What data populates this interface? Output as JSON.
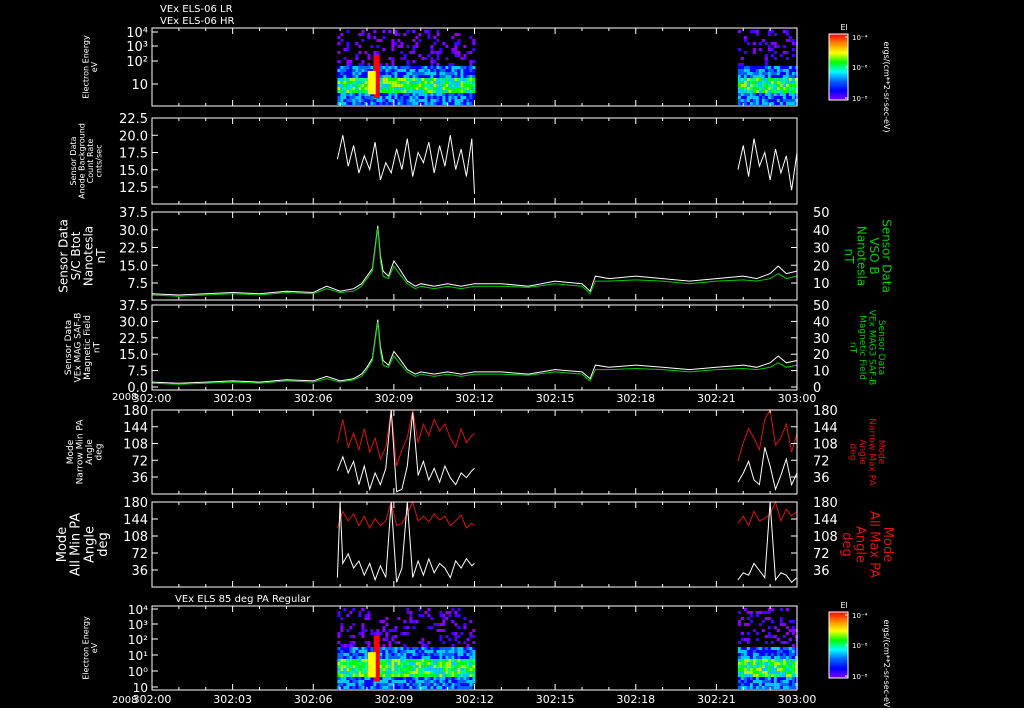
{
  "header": {
    "line1": "VEx ELS-06 LR",
    "line2": "VEx ELS-06 HR"
  },
  "bottom_header": "VEx ELS 85 deg PA Regular",
  "colorbar": {
    "title": "El",
    "ticks": [
      "10⁻⁴",
      "10⁻⁶",
      "10⁻⁸"
    ],
    "unit": "ergs/(cm**2-sr-sec-eV)",
    "colors": [
      "#ff0000",
      "#ff8800",
      "#ffff00",
      "#00ff00",
      "#00ffff",
      "#0066ff",
      "#0000ff",
      "#8800ff"
    ]
  },
  "time_axis": {
    "year": "2008",
    "labels": [
      "302:00",
      "302:03",
      "302:06",
      "302:09",
      "302:12",
      "302:15",
      "302:18",
      "302:21",
      "303:00"
    ]
  },
  "colors": {
    "primary": "#ffffff",
    "green": "#00cc00",
    "red": "#dd1111",
    "axis": "#ffffff"
  },
  "chart_data": [
    {
      "type": "heatmap",
      "title": "VEx ELS-06 LR / HR",
      "ylabel": [
        "Electron Energy",
        "eV"
      ],
      "yticks": [
        "10⁴",
        "10³",
        "10²",
        "10"
      ],
      "coverage": [
        [
          6.9,
          12.0
        ],
        [
          21.8,
          24.0
        ]
      ]
    },
    {
      "type": "line",
      "ylabel": [
        "Sensor Data",
        "Anode Background",
        "Count Rate",
        "cnts/sec"
      ],
      "ylim": [
        10,
        22.5
      ],
      "yticks": [
        "22.5",
        "20.0",
        "17.5",
        "15.0",
        "12.5"
      ],
      "series": [
        {
          "color": "white",
          "segments": [
            {
              "x": [
                6.9,
                7.1,
                7.3,
                7.5,
                7.7,
                7.9,
                8.1,
                8.3,
                8.5,
                8.7,
                8.9,
                9.1,
                9.3,
                9.5,
                9.7,
                9.9,
                10.1,
                10.3,
                10.5,
                10.7,
                10.9,
                11.1,
                11.3,
                11.5,
                11.7,
                11.9,
                12.0
              ],
              "y": [
                16.5,
                20.0,
                15.5,
                18.5,
                14.5,
                17.0,
                15.0,
                19.0,
                13.5,
                16.0,
                14.5,
                18.0,
                15.0,
                19.5,
                14.0,
                17.5,
                16.0,
                19.0,
                14.5,
                18.5,
                15.5,
                20.0,
                15.0,
                18.0,
                14.0,
                19.5,
                11.5
              ]
            },
            {
              "x": [
                21.8,
                22.0,
                22.2,
                22.4,
                22.6,
                22.8,
                23.0,
                23.2,
                23.4,
                23.6,
                23.8,
                24.0
              ],
              "y": [
                15.0,
                18.5,
                14.0,
                19.5,
                15.5,
                17.5,
                13.5,
                18.0,
                14.5,
                17.0,
                12.0,
                17.5
              ]
            }
          ]
        }
      ]
    },
    {
      "type": "line",
      "ylabel": [
        "Sensor Data",
        "S/C Btot",
        "Nanotesla",
        "nT"
      ],
      "ylabel_right": [
        "Sensor Data",
        "VSO B",
        "Nanotesla",
        "nT"
      ],
      "ylim": [
        2.5,
        37.5
      ],
      "yticks": [
        "37.5",
        "30.0",
        "22.5",
        "15.0",
        "7.5"
      ],
      "ylim_right": [
        0,
        50
      ],
      "yticks_right": [
        "50",
        "40",
        "30",
        "20",
        "10"
      ],
      "series": [
        {
          "color": "white",
          "x": [
            0,
            1,
            2,
            3,
            4,
            5,
            6,
            6.5,
            7,
            7.5,
            7.8,
            8.0,
            8.2,
            8.4,
            8.5,
            8.6,
            8.8,
            9.0,
            9.2,
            9.5,
            9.8,
            10,
            10.5,
            11,
            11.5,
            12,
            13,
            14,
            15,
            16,
            16.3,
            16.5,
            17,
            18,
            19,
            20,
            21,
            22,
            22.5,
            23,
            23.3,
            23.6,
            24
          ],
          "y": [
            5,
            4.5,
            5,
            5.5,
            5,
            6,
            5.5,
            8,
            6,
            7,
            9,
            12,
            15,
            32,
            20,
            14,
            12,
            18,
            15,
            10,
            8,
            9,
            8,
            9,
            8,
            9,
            9,
            8,
            10,
            9,
            6,
            12,
            11,
            12,
            11,
            10,
            11,
            12,
            11,
            13,
            16,
            13,
            14
          ]
        },
        {
          "color": "green",
          "x": [
            0,
            1,
            2,
            3,
            4,
            5,
            6,
            6.5,
            7,
            7.5,
            7.8,
            8.0,
            8.2,
            8.4,
            8.5,
            8.6,
            8.8,
            9.0,
            9.2,
            9.5,
            9.8,
            10,
            10.5,
            11,
            11.5,
            12,
            13,
            14,
            15,
            16,
            16.3,
            16.5,
            17,
            18,
            19,
            20,
            21,
            22,
            22.5,
            23,
            23.3,
            23.6,
            24
          ],
          "y": [
            4.5,
            4,
            4.5,
            5,
            4.5,
            5.5,
            5,
            7,
            5.5,
            6,
            8,
            11,
            14,
            31,
            18,
            12,
            11,
            16,
            13,
            9,
            7,
            8,
            7,
            8,
            7,
            8,
            8,
            7.5,
            9,
            8,
            5,
            10,
            10,
            10.5,
            10,
            9,
            10,
            10.5,
            10,
            11,
            13,
            11,
            12
          ]
        }
      ]
    },
    {
      "type": "line",
      "ylabel": [
        "Sensor Data",
        "VEx MAG SAF-B",
        "Magnetic Field",
        "nT"
      ],
      "ylabel_right": [
        "Sensor Data",
        "VEx MAG3 SAF-B",
        "Magnetic Field",
        "nT"
      ],
      "ylim": [
        0,
        37.5
      ],
      "yticks": [
        "37.5",
        "30.0",
        "22.5",
        "15.0",
        "7.5",
        "0.0"
      ],
      "ylim_right": [
        0,
        50
      ],
      "yticks_right": [
        "50",
        "40",
        "30",
        "20",
        "10",
        "0"
      ],
      "series": [
        {
          "color": "white",
          "x": [
            0,
            1,
            2,
            3,
            4,
            5,
            6,
            6.5,
            7,
            7.5,
            7.8,
            8.0,
            8.2,
            8.4,
            8.5,
            8.6,
            8.8,
            9.0,
            9.2,
            9.5,
            9.8,
            10,
            10.5,
            11,
            11.5,
            12,
            13,
            14,
            15,
            16,
            16.3,
            16.5,
            17,
            18,
            19,
            20,
            21,
            22,
            22.5,
            23,
            23.3,
            23.6,
            24
          ],
          "y": [
            3.5,
            3,
            3.5,
            4,
            3.5,
            4.5,
            4,
            6,
            4,
            5,
            7,
            10,
            14,
            31,
            19,
            13,
            11,
            17,
            14,
            9,
            7,
            8,
            7,
            8,
            7,
            8,
            8,
            7,
            9,
            8,
            5,
            11,
            10,
            11,
            10,
            9,
            10,
            11,
            10,
            12,
            15,
            12,
            13
          ]
        },
        {
          "color": "green",
          "x": [
            0,
            1,
            2,
            3,
            4,
            5,
            6,
            6.5,
            7,
            7.5,
            7.8,
            8.0,
            8.2,
            8.4,
            8.5,
            8.6,
            8.8,
            9.0,
            9.2,
            9.5,
            9.8,
            10,
            10.5,
            11,
            11.5,
            12,
            13,
            14,
            15,
            16,
            16.3,
            16.5,
            17,
            18,
            19,
            20,
            21,
            22,
            22.5,
            23,
            23.3,
            23.6,
            24
          ],
          "y": [
            3,
            2.5,
            3,
            3.5,
            3,
            4,
            3.5,
            5,
            3.5,
            4.5,
            6,
            9,
            13,
            30,
            17,
            11,
            10,
            15,
            12,
            8,
            6,
            7,
            6,
            7,
            6,
            7,
            7,
            6.5,
            8,
            7,
            4,
            9,
            9,
            9.5,
            9,
            8,
            9,
            9.5,
            9,
            10,
            12,
            10,
            11
          ]
        }
      ]
    },
    {
      "type": "line",
      "ylabel": [
        "Mode",
        "Narrow Min PA",
        "Angle",
        "deg"
      ],
      "ylabel_right": [
        "Mode",
        "Narrow Max PA",
        "Angle",
        "deg"
      ],
      "ylim": [
        0,
        180
      ],
      "yticks": [
        "180",
        "144",
        "108",
        "72",
        "36"
      ],
      "yticks_right": [
        "180",
        "144",
        "108",
        "72",
        "36"
      ],
      "series": [
        {
          "color": "red",
          "segments": [
            {
              "x": [
                6.9,
                7.1,
                7.3,
                7.5,
                7.7,
                7.9,
                8.1,
                8.3,
                8.5,
                8.7,
                8.9,
                9.1,
                9.3,
                9.5,
                9.7,
                9.9,
                10.1,
                10.3,
                10.5,
                10.7,
                10.9,
                11.1,
                11.3,
                11.5,
                11.7,
                11.9,
                12.0
              ],
              "y": [
                110,
                160,
                100,
                130,
                95,
                140,
                90,
                120,
                75,
                100,
                180,
                60,
                95,
                120,
                180,
                110,
                150,
                125,
                160,
                135,
                150,
                120,
                100,
                140,
                110,
                125,
                130
              ]
            },
            {
              "x": [
                21.8,
                22.0,
                22.2,
                22.4,
                22.6,
                22.8,
                23.0,
                23.2,
                23.4,
                23.6,
                23.8,
                24.0
              ],
              "y": [
                70,
                110,
                140,
                120,
                95,
                160,
                180,
                105,
                120,
                150,
                90,
                130
              ]
            }
          ]
        },
        {
          "color": "white",
          "segments": [
            {
              "x": [
                6.9,
                7.1,
                7.3,
                7.5,
                7.7,
                7.9,
                8.1,
                8.3,
                8.5,
                8.7,
                8.9,
                9.1,
                9.3,
                9.5,
                9.7,
                9.9,
                10.1,
                10.3,
                10.5,
                10.7,
                10.9,
                11.1,
                11.3,
                11.5,
                11.7,
                11.9,
                12.0
              ],
              "y": [
                50,
                80,
                45,
                70,
                20,
                60,
                10,
                45,
                20,
                55,
                180,
                5,
                10,
                60,
                175,
                40,
                70,
                30,
                55,
                25,
                60,
                35,
                20,
                45,
                35,
                50,
                55
              ]
            },
            {
              "x": [
                21.8,
                22.0,
                22.2,
                22.4,
                22.6,
                22.8,
                23.0,
                23.2,
                23.4,
                23.6,
                23.8,
                24.0
              ],
              "y": [
                25,
                45,
                70,
                30,
                20,
                100,
                60,
                10,
                40,
                75,
                20,
                45
              ]
            }
          ]
        }
      ]
    },
    {
      "type": "line",
      "ylabel": [
        "Mode",
        "All Min PA",
        "Angle",
        "deg"
      ],
      "ylabel_right": [
        "Mode",
        "All Max PA",
        "Angle",
        "deg"
      ],
      "ylim": [
        0,
        180
      ],
      "yticks": [
        "180",
        "144",
        "108",
        "72",
        "36"
      ],
      "yticks_right": [
        "180",
        "144",
        "108",
        "72",
        "36"
      ],
      "series": [
        {
          "color": "red",
          "segments": [
            {
              "x": [
                6.9,
                7.1,
                7.3,
                7.5,
                7.7,
                7.9,
                8.1,
                8.3,
                8.5,
                8.7,
                8.9,
                9.1,
                9.3,
                9.5,
                9.7,
                9.9,
                10.1,
                10.3,
                10.5,
                10.7,
                10.9,
                11.1,
                11.3,
                11.5,
                11.7,
                11.9,
                12.0
              ],
              "y": [
                125,
                160,
                140,
                155,
                130,
                150,
                125,
                145,
                130,
                140,
                180,
                130,
                135,
                155,
                180,
                140,
                150,
                138,
                155,
                142,
                150,
                130,
                140,
                152,
                125,
                135,
                130
              ]
            },
            {
              "x": [
                21.8,
                22.0,
                22.2,
                22.4,
                22.6,
                22.8,
                23.0,
                23.2,
                23.4,
                23.6,
                23.8,
                24.0
              ],
              "y": [
                135,
                150,
                130,
                160,
                140,
                145,
                155,
                180,
                140,
                165,
                150,
                160
              ]
            }
          ]
        },
        {
          "color": "white",
          "segments": [
            {
              "x": [
                6.9,
                7.0,
                7.1,
                7.3,
                7.5,
                7.7,
                7.9,
                8.1,
                8.3,
                8.5,
                8.7,
                8.9,
                9.1,
                9.3,
                9.5,
                9.7,
                9.9,
                10.1,
                10.3,
                10.5,
                10.7,
                10.9,
                11.1,
                11.3,
                11.5,
                11.7,
                11.9,
                12.0
              ],
              "y": [
                20,
                180,
                50,
                70,
                40,
                55,
                25,
                50,
                15,
                45,
                20,
                180,
                10,
                40,
                180,
                20,
                55,
                25,
                60,
                30,
                50,
                40,
                20,
                55,
                40,
                60,
                45,
                50
              ]
            },
            {
              "x": [
                21.8,
                22.0,
                22.2,
                22.4,
                22.6,
                22.8,
                23.0,
                23.2,
                23.4,
                23.6,
                23.8,
                24.0
              ],
              "y": [
                15,
                30,
                25,
                50,
                35,
                20,
                180,
                15,
                30,
                25,
                10,
                20
              ]
            }
          ]
        }
      ]
    },
    {
      "type": "heatmap",
      "title": "VEx ELS 85 deg PA Regular",
      "ylabel": [
        "Electron Energy",
        "eV"
      ],
      "yticks": [
        "10⁴",
        "10³",
        "10²",
        "10¹",
        "10⁰",
        "10"
      ],
      "coverage": [
        [
          6.9,
          12.0
        ],
        [
          21.8,
          24.0
        ]
      ]
    }
  ]
}
